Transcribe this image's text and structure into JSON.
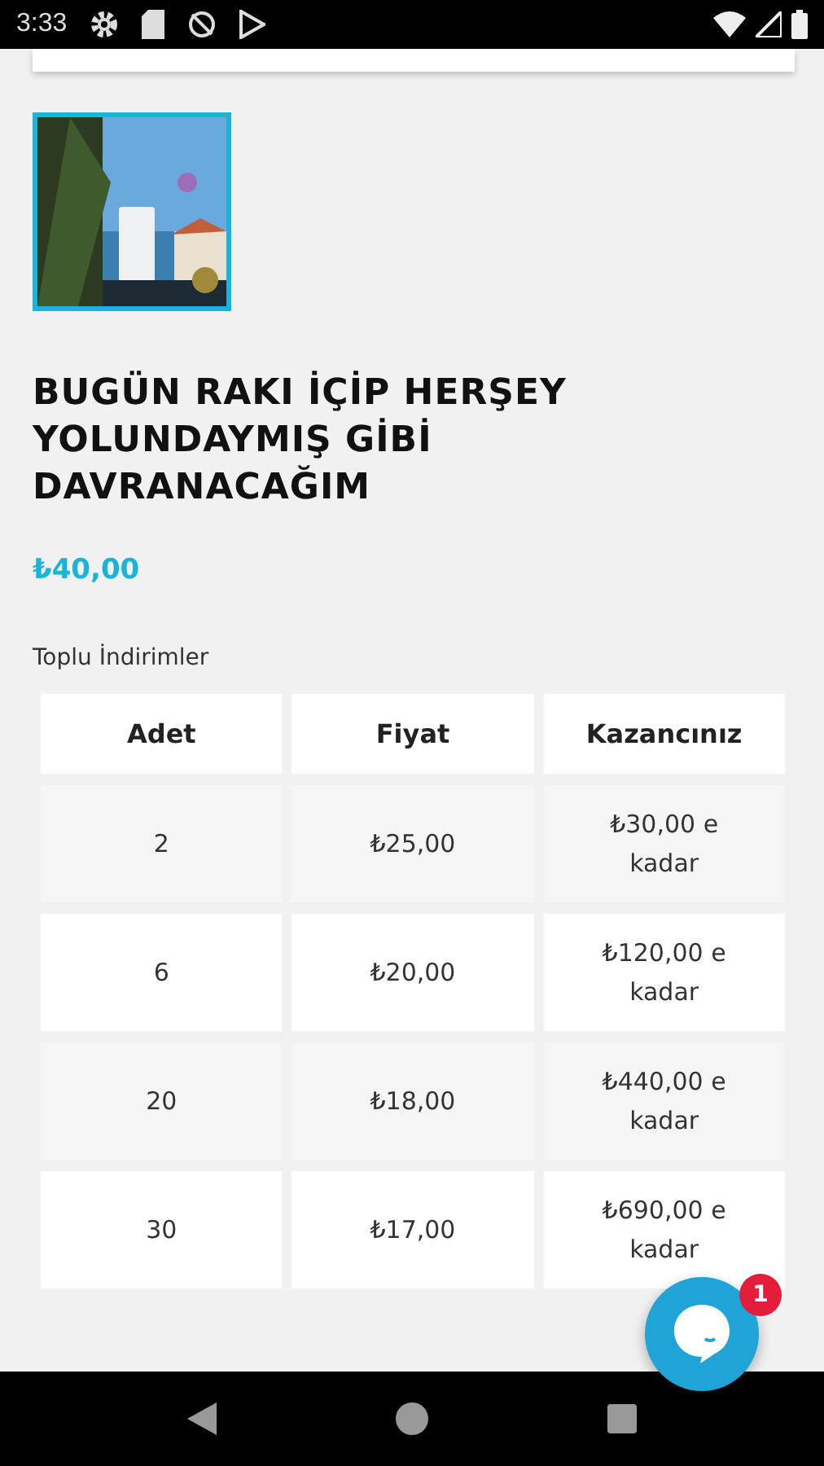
{
  "status_bar": {
    "time": "3:33"
  },
  "product": {
    "title": "BUGÜN RAKI İÇİP HERŞEY YOLUNDAYMIŞ GİBİ DAVRANACAĞIM",
    "price": "₺40,00"
  },
  "bulk_discounts": {
    "heading": "Toplu İndirimler",
    "columns": [
      "Adet",
      "Fiyat",
      "Kazancınız"
    ],
    "rows": [
      {
        "cells": [
          "2",
          "₺25,00",
          "₺30,00 e kadar"
        ]
      },
      {
        "cells": [
          "6",
          "₺20,00",
          "₺120,00 e kadar"
        ]
      },
      {
        "cells": [
          "20",
          "₺18,00",
          "₺440,00 e kadar"
        ]
      },
      {
        "cells": [
          "30",
          "₺17,00",
          "₺690,00 e kadar"
        ]
      }
    ]
  },
  "chat": {
    "badge": "1"
  }
}
